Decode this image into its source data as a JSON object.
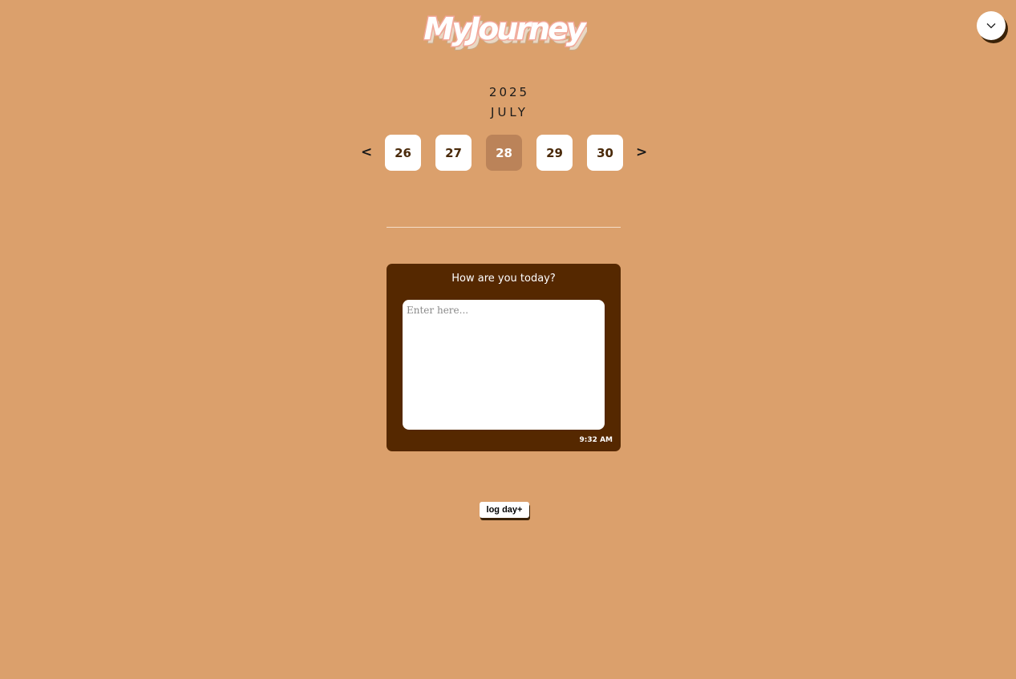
{
  "app": {
    "logo_text": "MyJourney"
  },
  "header": {
    "menu_icon": "chevron-down-icon"
  },
  "calendar": {
    "year": "2025",
    "month": "JULY",
    "prev_label": "<",
    "next_label": ">",
    "days": [
      "26",
      "27",
      "28",
      "29",
      "30"
    ],
    "selected_day": "28"
  },
  "entry_card": {
    "title": "How are you today?",
    "placeholder": "Enter here...",
    "time": "9:32 AM"
  },
  "actions": {
    "log_day_label": "log day+"
  },
  "colors": {
    "background": "#dba06c",
    "card": "#552800",
    "selected_day": "#bb8359",
    "day_text": "#4a2a0a",
    "logo_fill": "#ffffff",
    "logo_outline": "#f2a89a",
    "logo_shadow": "#e9d8c4"
  }
}
